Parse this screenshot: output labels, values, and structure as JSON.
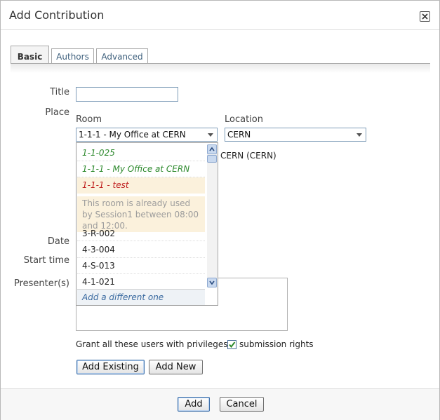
{
  "dialog": {
    "title": "Add Contribution"
  },
  "tabs": [
    {
      "label": "Basic",
      "active": true
    },
    {
      "label": "Authors",
      "active": false
    },
    {
      "label": "Advanced",
      "active": false
    }
  ],
  "form": {
    "title_label": "Title",
    "title_value": "",
    "place_label": "Place",
    "room_label": "Room",
    "room_value": "1-1-1 - My Office at CERN",
    "location_label": "Location",
    "location_value": "CERN",
    "location_hint": "CERN (CERN)",
    "date_label": "Date",
    "start_time_label": "Start time",
    "presenters_label": "Presenter(s)",
    "grant_label": "Grant all these users with privileges:",
    "submission_label": "submission rights",
    "submission_checked": true,
    "add_existing_label": "Add Existing",
    "add_new_label": "Add New"
  },
  "room_dropdown": {
    "items": [
      {
        "text": "1-1-025",
        "style": "green"
      },
      {
        "text": "1-1-1 - My Office at CERN",
        "style": "green"
      },
      {
        "text": "1-1-1 - test",
        "style": "red"
      },
      {
        "text": "3-R-002",
        "style": "plain"
      },
      {
        "text": "4-3-004",
        "style": "plain"
      },
      {
        "text": "4-S-013",
        "style": "plain"
      },
      {
        "text": "4-1-021",
        "style": "plain"
      }
    ],
    "conflict_note": "This room is already used by Session1 between 08:00 and 12:00.",
    "add_different": "Add a different one"
  },
  "footer": {
    "add_label": "Add",
    "cancel_label": "Cancel"
  },
  "colors": {
    "accent": "#3d5f7c",
    "available": "#2e8a2e",
    "conflict": "#bf1e1e",
    "conflict_bg": "#fbf1dc"
  }
}
